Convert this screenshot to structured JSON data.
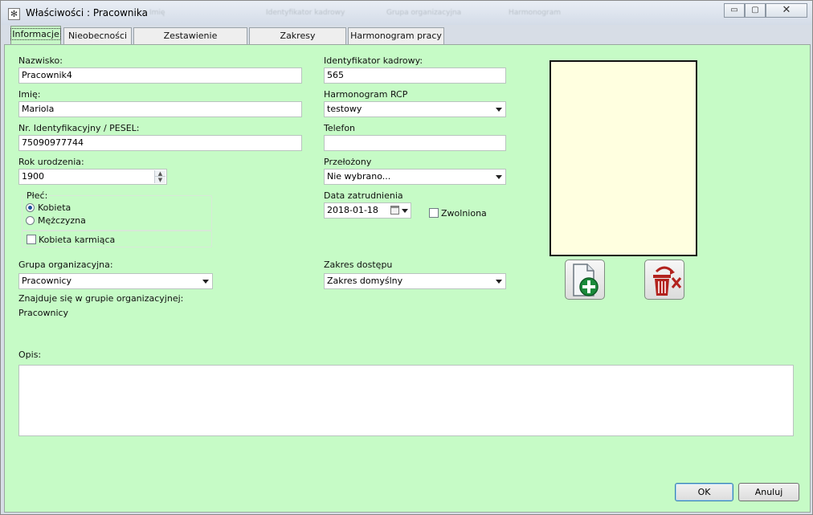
{
  "window": {
    "title": "Właściwości : Pracownika",
    "background_header_items": [
      "Imię",
      "Identyfikator kadrowy",
      "Grupa organizacyjna",
      "Harmonogram"
    ],
    "controls": {
      "minimize": "▭",
      "maximize": "▢",
      "close": "✕"
    }
  },
  "tabs": [
    {
      "label": "Informacje",
      "active": true
    },
    {
      "label": "Nieobecności",
      "active": false
    },
    {
      "label": "Zestawienie nieobecności",
      "active": false
    },
    {
      "label": "Zakresy nieobecności",
      "active": false
    },
    {
      "label": "Harmonogram pracy",
      "active": false
    }
  ],
  "form": {
    "nazwisko": {
      "label": "Nazwisko:",
      "value": "Pracownik4"
    },
    "imie": {
      "label": "Imię:",
      "value": "Mariola"
    },
    "pesel": {
      "label": "Nr. Identyfikacyjny / PESEL:",
      "value": "75090977744"
    },
    "rok_urodzenia": {
      "label": "Rok urodzenia:",
      "value": "1900"
    },
    "plec": {
      "label": "Płeć:",
      "options": [
        {
          "label": "Kobieta",
          "checked": true
        },
        {
          "label": "Mężczyzna",
          "checked": false
        }
      ]
    },
    "kobieta_karmiaca": {
      "label": "Kobieta karmiąca",
      "checked": false
    },
    "grupa_organizacyjna": {
      "label": "Grupa organizacyjna:",
      "value": "Pracownicy"
    },
    "znajduje_sie": {
      "label": "Znajduje się w grupie organizacyjnej:",
      "value": "Pracownicy"
    },
    "identyfikator": {
      "label": "Identyfikator kadrowy:",
      "value": "565"
    },
    "harmonogram_rcp": {
      "label": "Harmonogram RCP",
      "value": "testowy"
    },
    "telefon": {
      "label": "Telefon",
      "value": ""
    },
    "przelozony": {
      "label": "Przełożony",
      "value": "Nie wybrano..."
    },
    "data_zatrudnienia": {
      "label": "Data zatrudnienia",
      "value": "2018-01-18"
    },
    "zwolniona": {
      "label": "Zwolniona",
      "checked": false
    },
    "zakres_dostepu": {
      "label": "Zakres dostępu",
      "value": "Zakres domyślny"
    },
    "opis": {
      "label": "Opis:",
      "value": ""
    }
  },
  "buttons": {
    "ok": "OK",
    "cancel": "Anuluj"
  },
  "colors": {
    "panel": "#c6fbc6",
    "photo_bg": "#ffffe0",
    "add_icon": "#1a8a3a",
    "delete_icon": "#b2231e"
  }
}
